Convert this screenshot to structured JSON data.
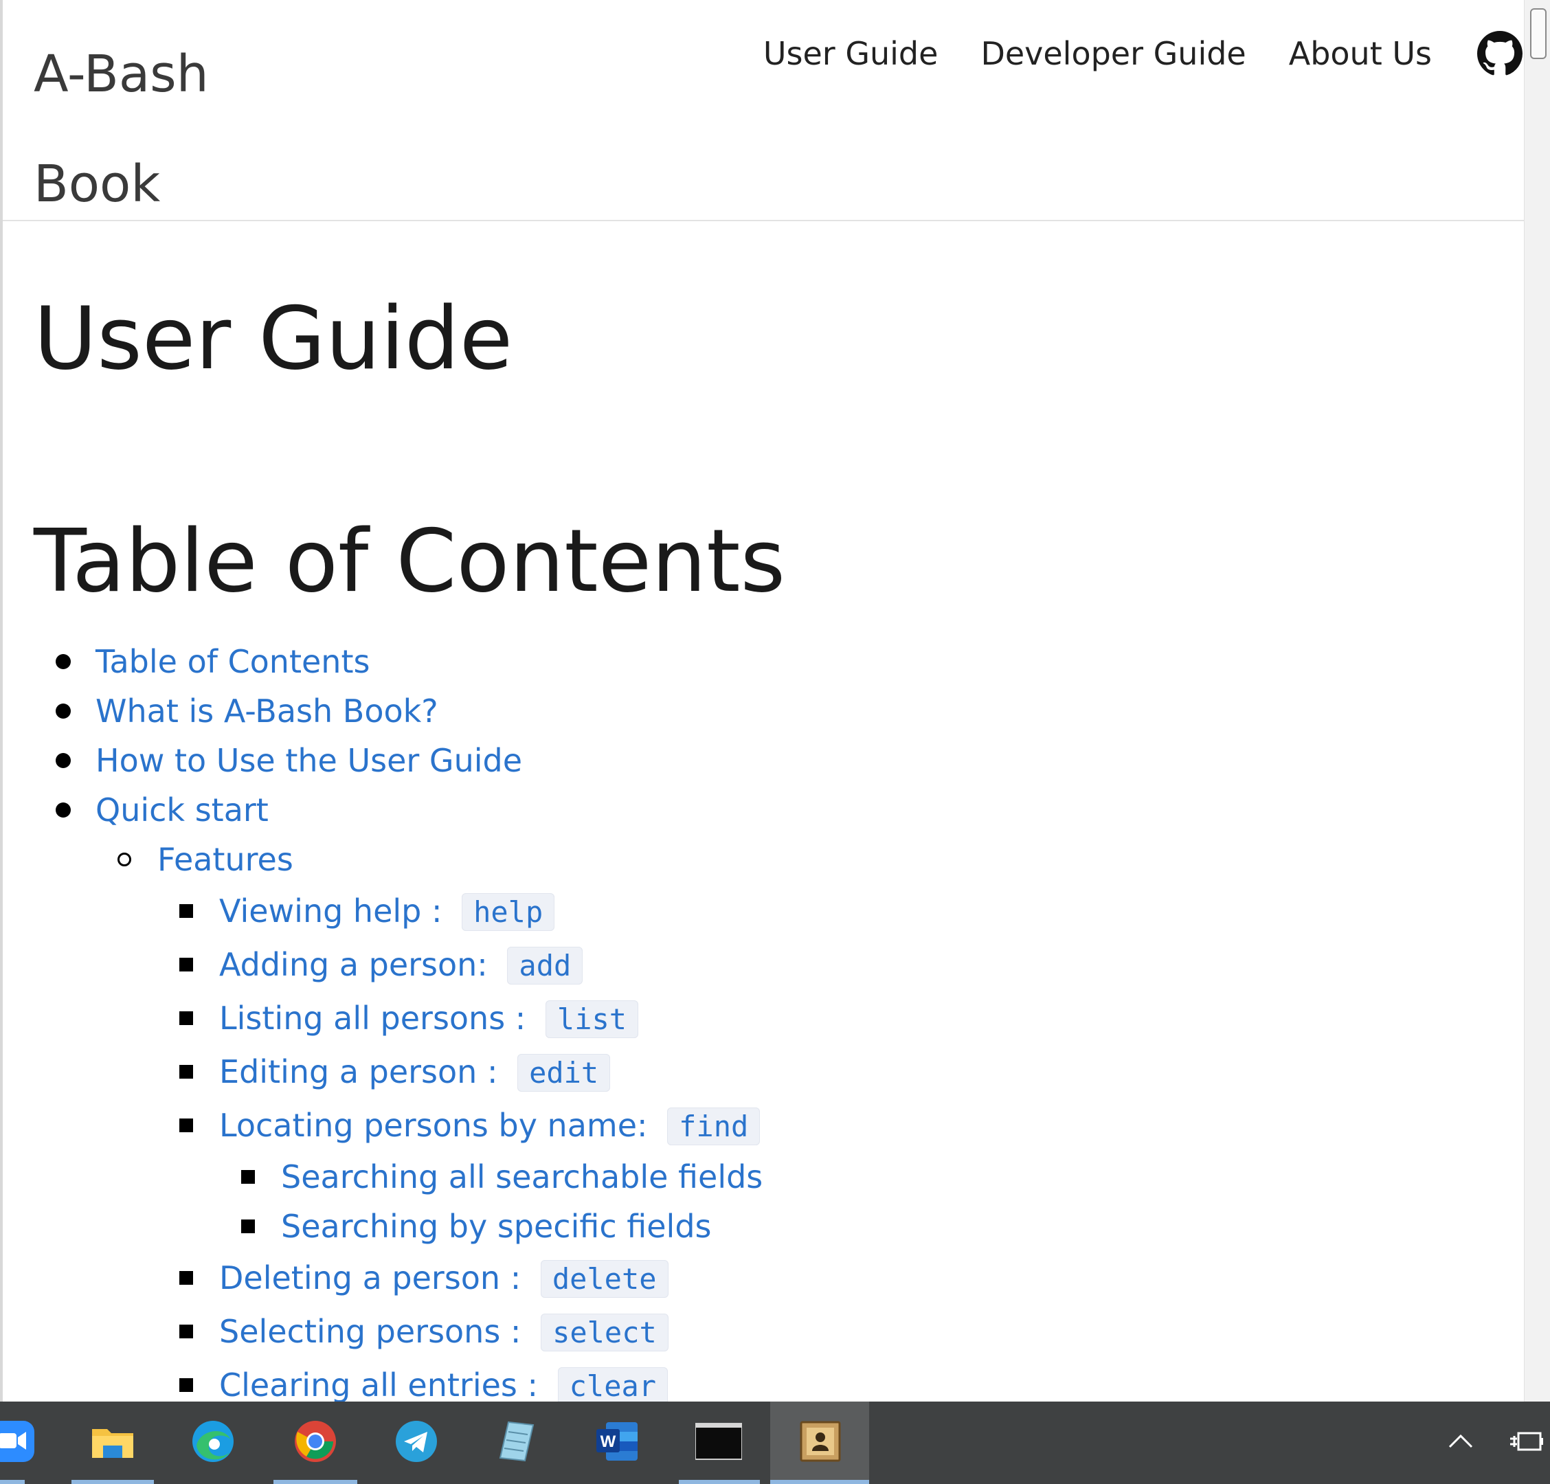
{
  "header": {
    "brand": "A-Bash Book",
    "nav": [
      {
        "label": "User Guide"
      },
      {
        "label": "Developer Guide"
      },
      {
        "label": "About Us"
      }
    ],
    "github_icon": "github-icon"
  },
  "content": {
    "title": "User Guide",
    "toc_heading": "Table of Contents",
    "toc": {
      "top": [
        "Table of Contents",
        "What is A-Bash Book?",
        "How to Use the User Guide",
        "Quick start"
      ],
      "features": "Features",
      "items": [
        {
          "label": "Viewing help : ",
          "code": "help"
        },
        {
          "label": "Adding a person: ",
          "code": "add"
        },
        {
          "label": "Listing all persons : ",
          "code": "list"
        },
        {
          "label": "Editing a person : ",
          "code": "edit"
        },
        {
          "label": "Locating persons by name: ",
          "code": "find"
        }
      ],
      "sub_items": [
        "Searching all searchable fields",
        "Searching by specific fields"
      ],
      "items_after": [
        {
          "label": "Deleting a person : ",
          "code": "delete"
        },
        {
          "label": "Selecting persons : ",
          "code": "select"
        },
        {
          "label": "Clearing all entries : ",
          "code": "clear"
        }
      ]
    }
  },
  "taskbar": {
    "apps": [
      "zoom-icon",
      "file-explorer-icon",
      "edge-icon",
      "chrome-icon",
      "telegram-icon",
      "notepad-icon",
      "word-icon",
      "terminal-icon",
      "addressbook-icon"
    ],
    "tray": [
      "chevron-up-icon",
      "power-icon"
    ]
  },
  "colors": {
    "link": "#2a73cc",
    "code_bg": "#eef1f7",
    "taskbar": "#3f4142",
    "accent": "#1a73d6"
  }
}
